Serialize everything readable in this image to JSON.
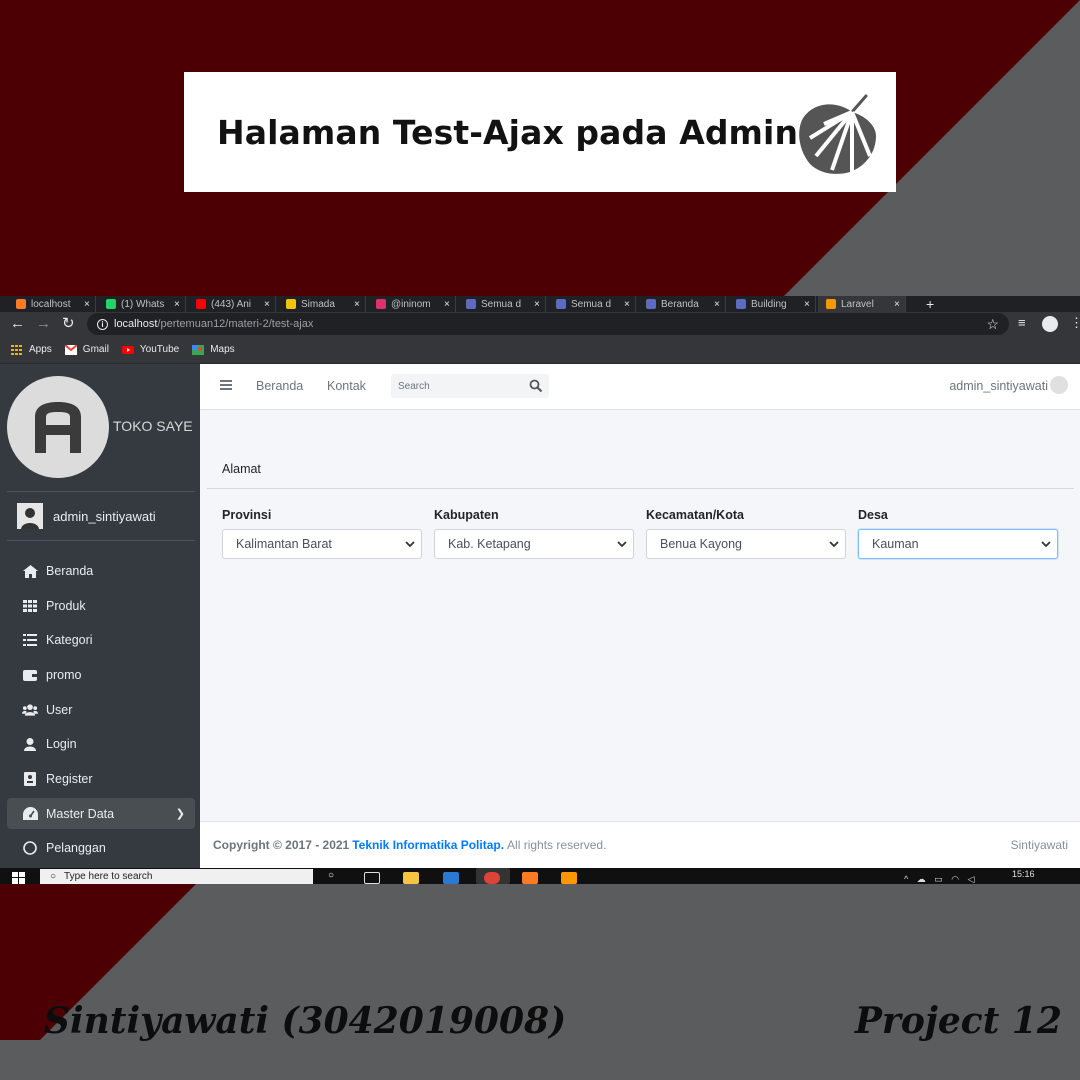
{
  "poster": {
    "title": "Halaman Test-Ajax pada Admin",
    "author": "Sintiyawati (3042019008)",
    "project": "Project 12",
    "colors": {
      "maroon": "#4d0004",
      "gray": "#5b5c5e"
    },
    "decor_icon": "monstera-leaf-icon"
  },
  "browser": {
    "tabs": [
      {
        "label": "localhost",
        "icon": "xampp-icon",
        "color": "#fb7a24"
      },
      {
        "label": "(1) Whats",
        "icon": "whatsapp-icon",
        "color": "#25d366"
      },
      {
        "label": "(443) Ani",
        "icon": "youtube-icon",
        "color": "#ff0000"
      },
      {
        "label": "Simada",
        "icon": "sheet-icon",
        "color": "#f4c20d"
      },
      {
        "label": "@ininom",
        "icon": "instagram-icon",
        "color": "#e1306c"
      },
      {
        "label": "Semua d",
        "icon": "site-icon",
        "color": "#5c6bc0"
      },
      {
        "label": "Semua d",
        "icon": "site-icon",
        "color": "#5c6bc0"
      },
      {
        "label": "Beranda",
        "icon": "site-icon",
        "color": "#5c6bc0"
      },
      {
        "label": "Building",
        "icon": "site-icon",
        "color": "#5c6bc0"
      },
      {
        "label": "Laravel",
        "icon": "laravel-icon",
        "color": "#ff9800"
      }
    ],
    "url_host": "localhost",
    "url_path": "/pertemuan12/materi-2/test-ajax",
    "bookmarks": [
      {
        "label": "Apps",
        "icon": "apps-grid-icon"
      },
      {
        "label": "Gmail",
        "icon": "gmail-icon"
      },
      {
        "label": "YouTube",
        "icon": "youtube-icon"
      },
      {
        "label": "Maps",
        "icon": "maps-icon"
      }
    ]
  },
  "sidebar": {
    "brand_name": "TOKO SAYE",
    "user_name": "admin_sintiyawati",
    "items": [
      {
        "label": "Beranda",
        "icon": "home-icon"
      },
      {
        "label": "Produk",
        "icon": "grid-icon"
      },
      {
        "label": "Kategori",
        "icon": "list-icon"
      },
      {
        "label": "promo",
        "icon": "wallet-icon"
      },
      {
        "label": "User",
        "icon": "users-icon"
      },
      {
        "label": "Login",
        "icon": "user-icon"
      },
      {
        "label": "Register",
        "icon": "id-card-icon"
      },
      {
        "label": "Master Data",
        "icon": "dashboard-icon",
        "active": true
      },
      {
        "label": "Pelanggan",
        "icon": "circle-icon"
      }
    ]
  },
  "topnav": {
    "links": [
      "Beranda",
      "Kontak"
    ],
    "search_placeholder": "Search",
    "user": "admin_sintiyawati"
  },
  "form": {
    "section_title": "Alamat",
    "fields": [
      {
        "label": "Provinsi",
        "value": "Kalimantan Barat"
      },
      {
        "label": "Kabupaten",
        "value": "Kab. Ketapang"
      },
      {
        "label": "Kecamatan/Kota",
        "value": "Benua Kayong"
      },
      {
        "label": "Desa",
        "value": "Kauman"
      }
    ]
  },
  "footer": {
    "copyright": "Copyright © 2017 - 2021",
    "link": "Teknik Informatika Politap.",
    "rights": "All rights reserved.",
    "right_text": "Sintiyawati"
  },
  "taskbar": {
    "search_placeholder": "Type here to search",
    "time": "15:16"
  }
}
